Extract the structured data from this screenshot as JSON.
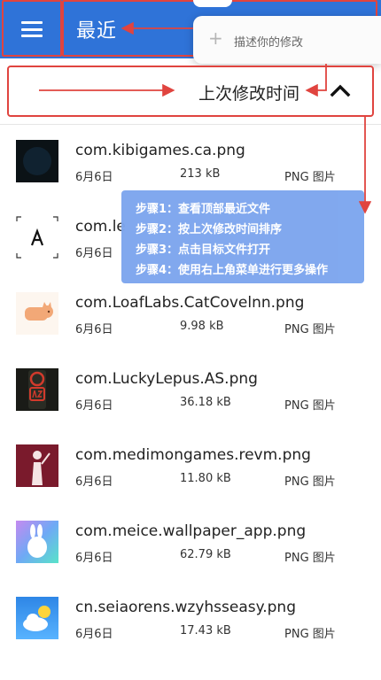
{
  "appbar": {
    "title": "最近",
    "menu_icon": "hamburger-menu-icon",
    "color": "#2f73d8"
  },
  "popup": {
    "icon": "plus-icon",
    "text": "描述你的修改"
  },
  "sort": {
    "label": "上次修改时间",
    "icon": "chevron-up-icon"
  },
  "files": [
    {
      "name": "com.kibigames.ca.png",
      "date": "6月6日",
      "size": "213 kB",
      "type": "PNG 图片"
    },
    {
      "name": "com.le",
      "date": "6月6日",
      "size": "",
      "type": ""
    },
    {
      "name": "com.LoafLabs.CatCovelnn.png",
      "date": "6月6日",
      "size": "9.98 kB",
      "type": "PNG 图片"
    },
    {
      "name": "com.LuckyLepus.AS.png",
      "date": "6月6日",
      "size": "36.18 kB",
      "type": "PNG 图片"
    },
    {
      "name": "com.medimongames.revm.png",
      "date": "6月6日",
      "size": "11.80 kB",
      "type": "PNG 图片"
    },
    {
      "name": "com.meice.wallpaper_app.png",
      "date": "6月6日",
      "size": "62.79 kB",
      "type": "PNG 图片"
    },
    {
      "name": "cn.seiaorens.wzyhsseasy.png",
      "date": "6月6日",
      "size": "17.43 kB",
      "type": "PNG 图片"
    }
  ],
  "tooltip": {
    "steps": [
      "步骤1：查看顶部最近文件",
      "步骤2：按上次修改时间排序",
      "步骤3：点击目标文件打开",
      "步骤4：使用右上角菜单进行更多操作"
    ]
  },
  "annotation_color": "#e0443f"
}
